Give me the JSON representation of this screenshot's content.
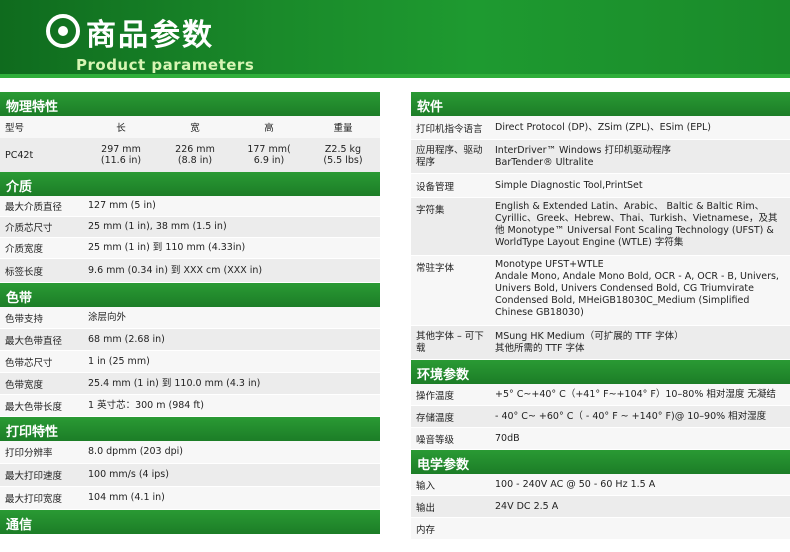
{
  "banner": {
    "title_cn": "商品参数",
    "title_en": "Product parameters"
  },
  "physical": {
    "title": "物理特性",
    "headers": [
      "型号",
      "长",
      "宽",
      "高",
      "重量"
    ],
    "model": "PC42t",
    "length": [
      "297 mm",
      "(11.6 in)"
    ],
    "width": [
      "226 mm",
      "(8.8 in)"
    ],
    "height": [
      "177 mm(",
      "6.9 in)"
    ],
    "weight": [
      "Z2.5 kg",
      "(5.5 lbs)"
    ]
  },
  "media": {
    "title": "介质",
    "rows": [
      {
        "label": "最大介质直径",
        "value": "127 mm (5 in)"
      },
      {
        "label": "介质芯尺寸",
        "value": "25 mm (1 in), 38 mm (1.5 in)"
      },
      {
        "label": "介质宽度",
        "value": "25 mm (1 in) 到 110 mm (4.33in)"
      },
      {
        "label": "标签长度",
        "value": "9.6 mm (0.34 in) 到 XXX cm (XXX in)"
      }
    ]
  },
  "ribbon": {
    "title": "色带",
    "rows": [
      {
        "label": "色带支持",
        "value": "涂层向外"
      },
      {
        "label": "最大色带直径",
        "value": "68 mm (2.68 in)"
      },
      {
        "label": "色带芯尺寸",
        "value": "1 in (25 mm)"
      },
      {
        "label": "色带宽度",
        "value": "25.4 mm (1 in) 到 110.0 mm (4.3 in)"
      },
      {
        "label": "最大色带长度",
        "value": "1 英寸芯：300 m (984 ft)"
      }
    ]
  },
  "print": {
    "title": "打印特性",
    "rows": [
      {
        "label": "打印分辨率",
        "value": "8.0 dpmm (203 dpi)"
      },
      {
        "label": "最大打印速度",
        "value": "100 mm/s (4 ips)"
      },
      {
        "label": "最大打印宽度",
        "value": "104 mm (4.1 in)"
      }
    ]
  },
  "comm": {
    "title": "通信"
  },
  "software": {
    "title": "软件",
    "rows": [
      {
        "label": "打印机指令语言",
        "value": "Direct Protocol (DP)、ZSim (ZPL)、ESim (EPL)"
      },
      {
        "label": "应用程序、驱动程序",
        "value": "InterDriver™ Windows 打印机驱动程序\nBarTender® Ultralite"
      },
      {
        "label": "设备管理",
        "value": "Simple Diagnostic Tool,PrintSet"
      },
      {
        "label": "字符集",
        "value": "English & Extended Latin、Arabic、 Baltic & Baltic Rim、Cyrillic、Greek、Hebrew、Thai、Turkish、Vietnamese，及其他 Monotype™ Universal Font Scaling Technology (UFST) & WorldType Layout Engine (WTLE) 字符集"
      },
      {
        "label": "常驻字体",
        "value": "Monotype UFST+WTLE\nAndale Mono, Andale Mono Bold, OCR - A, OCR - B, Univers, Univers Bold, Univers Condensed Bold, CG Triumvirate Condensed Bold, MHeiGB18030C_Medium (Simplified Chinese GB18030)"
      },
      {
        "label": "其他字体 – 可下载",
        "value": "MSung HK Medium（可扩展的 TTF 字体）\n其他所需的 TTF 字体"
      }
    ]
  },
  "environment": {
    "title": "环境参数",
    "rows": [
      {
        "label": "操作温度",
        "value": "+5°  C~+40°  C（+41°  F~+104°  F）10–80% 相对湿度 无凝结"
      },
      {
        "label": "存储温度",
        "value": "- 40°  C~ +60°  C（ - 40°  F ~ +140°  F)@ 10–90% 相对湿度"
      },
      {
        "label": "噪音等级",
        "value": "70dB"
      }
    ]
  },
  "electrical": {
    "title": "电学参数",
    "rows": [
      {
        "label": "输入",
        "value": "100 - 240V AC @ 50 - 60 Hz 1.5 A"
      },
      {
        "label": "输出",
        "value": "24V DC 2.5 A"
      },
      {
        "label": "内存",
        "value": ""
      }
    ]
  }
}
